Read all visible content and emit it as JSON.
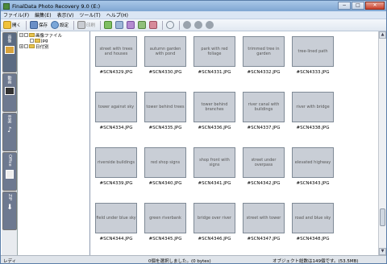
{
  "window": {
    "title": "FinalData Photo Recovery 9.0 (E:)",
    "minimize": "−",
    "maximize": "□",
    "close": "✕"
  },
  "menu": [
    "ファイル(F)",
    "編集(E)",
    "表示(V)",
    "ツール(T)",
    "ヘルプ(H)"
  ],
  "toolbar": {
    "open_label": "開く",
    "save_label": "保存",
    "settings_label": "設定",
    "print_label": "印刷"
  },
  "left_tabs": [
    "画像",
    "動画",
    "音楽",
    "Office",
    "ZIP"
  ],
  "tree": {
    "root": "画像ファイル",
    "child": "jpg",
    "date_node": "日付別"
  },
  "thumbnails": [
    {
      "caption": "#SCN4329.JPG",
      "image": "street with trees and houses"
    },
    {
      "caption": "#SCN4330.JPG",
      "image": "autumn garden with pond"
    },
    {
      "caption": "#SCN4331.JPG",
      "image": "park with red foliage"
    },
    {
      "caption": "#SCN4332.JPG",
      "image": "trimmed tree in garden"
    },
    {
      "caption": "#SCN4333.JPG",
      "image": "tree-lined path"
    },
    {
      "caption": "#SCN4334.JPG",
      "image": "tower against sky"
    },
    {
      "caption": "#SCN4335.JPG",
      "image": "tower behind trees"
    },
    {
      "caption": "#SCN4336.JPG",
      "image": "tower behind branches"
    },
    {
      "caption": "#SCN4337.JPG",
      "image": "river canal with buildings"
    },
    {
      "caption": "#SCN4338.JPG",
      "image": "river with bridge"
    },
    {
      "caption": "#SCN4339.JPG",
      "image": "riverside buildings"
    },
    {
      "caption": "#SCN4340.JPG",
      "image": "red shop signs"
    },
    {
      "caption": "#SCN4341.JPG",
      "image": "shop front with signs"
    },
    {
      "caption": "#SCN4342.JPG",
      "image": "street under overpass"
    },
    {
      "caption": "#SCN4343.JPG",
      "image": "elevated highway"
    },
    {
      "caption": "#SCN4344.JPG",
      "image": "field under blue sky"
    },
    {
      "caption": "#SCN4345.JPG",
      "image": "green riverbank"
    },
    {
      "caption": "#SCN4346.JPG",
      "image": "bridge over river"
    },
    {
      "caption": "#SCN4347.JPG",
      "image": "street with tower"
    },
    {
      "caption": "#SCN4348.JPG",
      "image": "road and blue sky"
    }
  ],
  "status": {
    "ready": "レディ",
    "selection": "0個を選択しました。(0 bytes)",
    "object_count": "オブジェクト総数は149個です。(53.5MB)"
  },
  "colors": {
    "title_bar": "#7fa6d2",
    "menu_bar": "#dbe6f4",
    "status_bar": "#dfe4ea",
    "left_tab_bg": "#5b6b82"
  }
}
